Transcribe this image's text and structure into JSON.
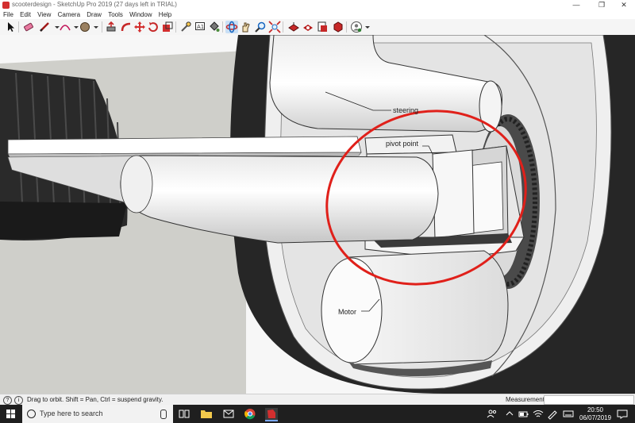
{
  "window": {
    "title": "scooterdesign - SketchUp Pro 2019 (27 days left in TRIAL)",
    "minimize_glyph": "—",
    "restore_glyph": "❐",
    "close_glyph": "✕"
  },
  "menu": {
    "items": [
      {
        "label": "File"
      },
      {
        "label": "Edit"
      },
      {
        "label": "View"
      },
      {
        "label": "Camera"
      },
      {
        "label": "Draw"
      },
      {
        "label": "Tools"
      },
      {
        "label": "Window"
      },
      {
        "label": "Help"
      }
    ]
  },
  "toolbar": {
    "tools": [
      "select",
      "eraser",
      "line",
      "arc",
      "shape",
      "paint",
      "push-pull",
      "move",
      "rotate",
      "scale",
      "offset",
      "tape-measure",
      "text",
      "paint-bucket",
      "orbit",
      "pan",
      "zoom",
      "zoom-extents",
      "warehouse",
      "extension-warehouse",
      "layout",
      "extension-manager",
      "account"
    ]
  },
  "model": {
    "labels": {
      "steering": "steering",
      "pivot": "pivot point",
      "motor": "Motor"
    },
    "annotation_color": "#e0201a"
  },
  "status": {
    "hint": "Drag to orbit. Shift = Pan, Ctrl = suspend gravity.",
    "measurements_label": "Measurements",
    "info_icon": "i",
    "help_icon": "?"
  },
  "taskbar": {
    "search_placeholder": "Type here to search",
    "time": "20:50",
    "date": "06/07/2019"
  }
}
